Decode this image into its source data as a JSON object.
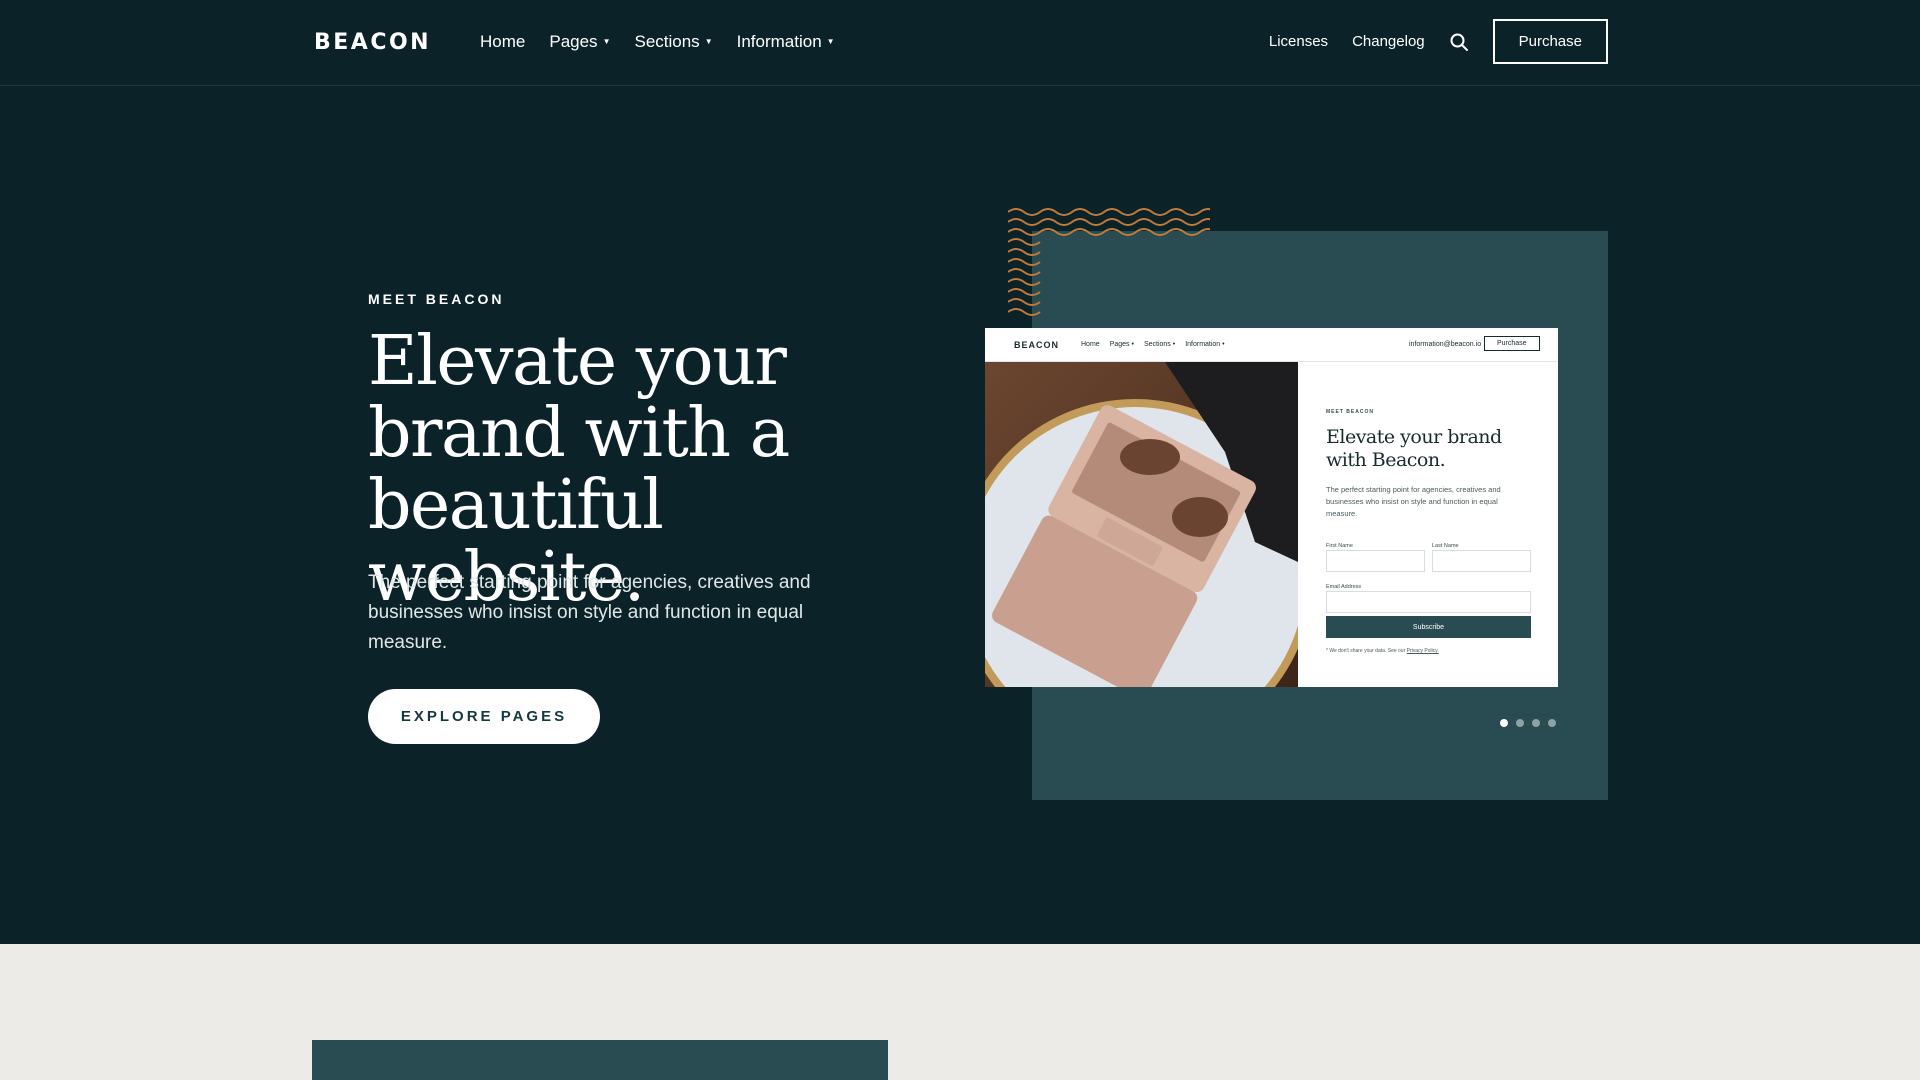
{
  "nav": {
    "logo": "BEACON",
    "links": [
      {
        "label": "Home",
        "caret": false
      },
      {
        "label": "Pages",
        "caret": true
      },
      {
        "label": "Sections",
        "caret": true
      },
      {
        "label": "Information",
        "caret": true
      }
    ],
    "right_links": [
      "Licenses",
      "Changelog"
    ],
    "search_icon": "search-icon",
    "purchase_label": "Purchase"
  },
  "hero": {
    "eyebrow": "MEET BEACON",
    "headline": "Elevate your brand with a beautiful website.",
    "subtext": "The perfect starting point for agencies, creatives and businesses who insist on style and function in equal measure.",
    "cta_label": "EXPLORE PAGES"
  },
  "carousel": {
    "slides": 4,
    "active_index": 0
  },
  "mockup": {
    "logo": "BEACON",
    "links": [
      "Home",
      "Pages •",
      "Sections •",
      "Information •"
    ],
    "email": "information@beacon.io",
    "purchase_label": "Purchase",
    "eyebrow": "MEET BEACON",
    "title": "Elevate your brand with Beacon.",
    "text": "The perfect starting point for agencies, creatives and businesses who insist on style and function in equal measure.",
    "first_name_label": "First Name",
    "last_name_label": "Last Name",
    "email_label": "Email Address",
    "subscribe_label": "Subscribe",
    "note_text": "* We don't share your data. See our",
    "note_link": "Privacy Policy."
  },
  "colors": {
    "background": "#0b2328",
    "panel": "#284c52",
    "accent_wave": "#c07a3c",
    "lower_background": "#ecebe7"
  }
}
